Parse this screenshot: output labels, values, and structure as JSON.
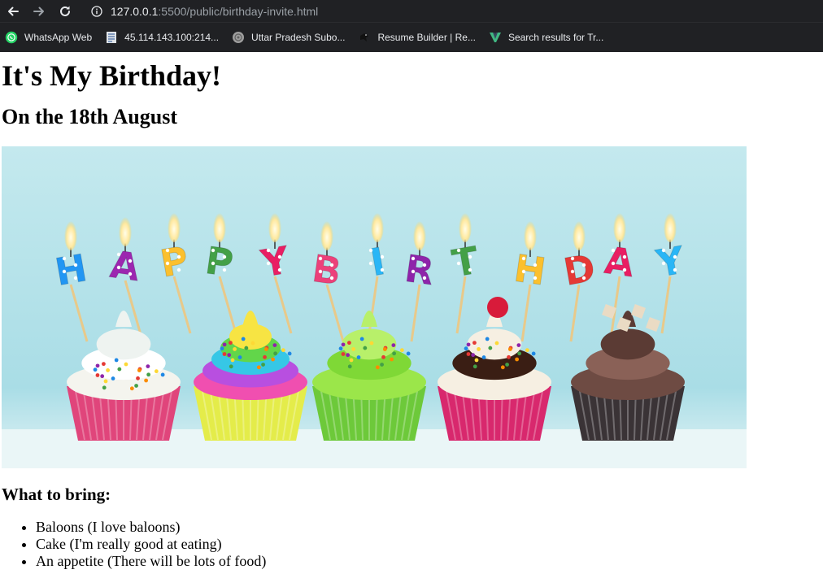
{
  "browser": {
    "url_host": "127.0.0.1",
    "url_path": ":5500/public/birthday-invite.html",
    "bookmarks": [
      {
        "label": "WhatsApp Web",
        "icon": "whatsapp-icon"
      },
      {
        "label": "45.114.143.100:214...",
        "icon": "document-icon"
      },
      {
        "label": "Uttar Pradesh Subo...",
        "icon": "emblem-icon"
      },
      {
        "label": "Resume Builder | Re...",
        "icon": "bird-icon"
      },
      {
        "label": "Search results for Tr...",
        "icon": "v-logo-icon"
      }
    ]
  },
  "page": {
    "title": "It's My Birthday!",
    "subtitle": "On the 18th August",
    "image_icon": "happy-birthday-cupcakes-image",
    "bring_heading": "What to bring:",
    "bring_items": [
      "Baloons (I love baloons)",
      "Cake (I'm really good at eating)",
      "An appetite (There will be lots of food)"
    ]
  },
  "colors": {
    "chrome_bg": "#202124",
    "hero_bg": "#bfe6ec"
  }
}
